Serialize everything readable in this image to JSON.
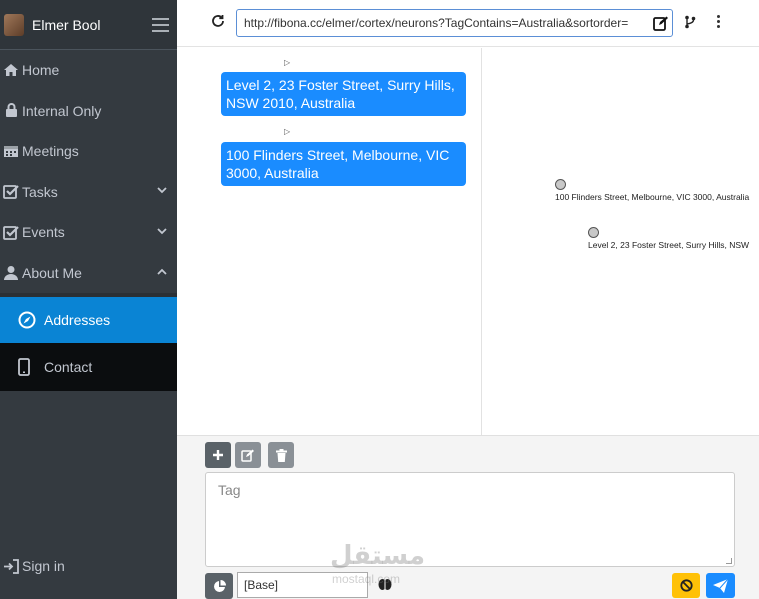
{
  "sidebar": {
    "user_name": "Elmer Bool",
    "items": [
      {
        "label": "Home",
        "icon": "home-icon"
      },
      {
        "label": "Internal Only",
        "icon": "lock-icon"
      },
      {
        "label": "Meetings",
        "icon": "calendar-icon"
      },
      {
        "label": "Tasks",
        "icon": "checkbox-icon"
      },
      {
        "label": "Events",
        "icon": "checkbox-icon"
      },
      {
        "label": "About Me",
        "icon": "user-icon"
      }
    ],
    "sub_items": [
      {
        "label": "Addresses",
        "icon": "compass-icon"
      },
      {
        "label": "Contact",
        "icon": "phone-icon"
      }
    ],
    "sign_in": "Sign in"
  },
  "topbar": {
    "url": "http://fibona.cc/elmer/cortex/neurons?TagContains=Australia&sortorder="
  },
  "cards": [
    {
      "text": "Level 2, 23 Foster Street, Surry Hills, NSW 2010, Australia"
    },
    {
      "text": "100 Flinders Street, Melbourne, VIC 3000, Australia"
    }
  ],
  "graph": {
    "nodes": [
      {
        "label": "100 Flinders Street, Melbourne, VIC 3000, Australia"
      },
      {
        "label": "Level 2, 23 Foster Street, Surry Hills, NSW"
      }
    ]
  },
  "editor": {
    "tag_placeholder": "Tag",
    "base_value": "[Base]"
  },
  "watermark": {
    "main": "مستقل",
    "sub": "mostaql.com"
  },
  "colors": {
    "sidebar_bg": "#343a40",
    "active_blue": "#0a84d4",
    "card_blue": "#1a8cff",
    "warning": "#ffc107"
  }
}
